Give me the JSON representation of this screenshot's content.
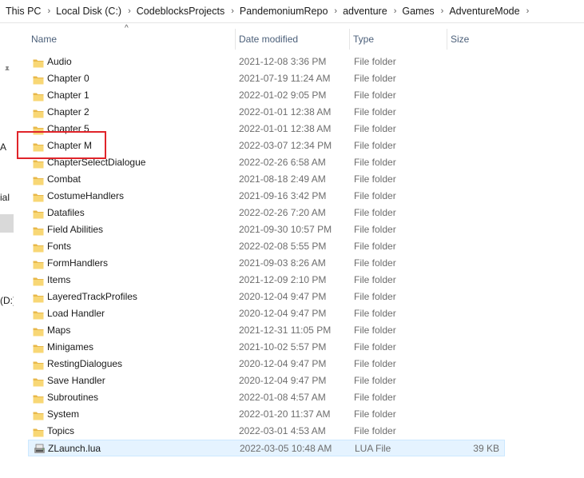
{
  "breadcrumb": [
    "This PC",
    "Local Disk (C:)",
    "CodeblocksProjects",
    "PandemoniumRepo",
    "adventure",
    "Games",
    "AdventureMode"
  ],
  "nav": {
    "fragments": [
      "A",
      "ial",
      "(D:)"
    ]
  },
  "columns": {
    "name": "Name",
    "date": "Date modified",
    "type": "Type",
    "size": "Size"
  },
  "files": [
    {
      "name": "Audio",
      "date": "2021-12-08 3:36 PM",
      "type": "File folder",
      "size": "",
      "icon": "folder-icon"
    },
    {
      "name": "Chapter 0",
      "date": "2021-07-19 11:24 AM",
      "type": "File folder",
      "size": "",
      "icon": "folder-icon"
    },
    {
      "name": "Chapter 1",
      "date": "2022-01-02 9:05 PM",
      "type": "File folder",
      "size": "",
      "icon": "folder-icon"
    },
    {
      "name": "Chapter 2",
      "date": "2022-01-01 12:38 AM",
      "type": "File folder",
      "size": "",
      "icon": "folder-icon"
    },
    {
      "name": "Chapter 5",
      "date": "2022-01-01 12:38 AM",
      "type": "File folder",
      "size": "",
      "icon": "folder-icon"
    },
    {
      "name": "Chapter M",
      "date": "2022-03-07 12:34 PM",
      "type": "File folder",
      "size": "",
      "icon": "folder-icon"
    },
    {
      "name": "ChapterSelectDialogue",
      "date": "2022-02-26 6:58 AM",
      "type": "File folder",
      "size": "",
      "icon": "folder-icon"
    },
    {
      "name": "Combat",
      "date": "2021-08-18 2:49 AM",
      "type": "File folder",
      "size": "",
      "icon": "folder-icon"
    },
    {
      "name": "CostumeHandlers",
      "date": "2021-09-16 3:42 PM",
      "type": "File folder",
      "size": "",
      "icon": "folder-icon"
    },
    {
      "name": "Datafiles",
      "date": "2022-02-26 7:20 AM",
      "type": "File folder",
      "size": "",
      "icon": "folder-icon"
    },
    {
      "name": "Field Abilities",
      "date": "2021-09-30 10:57 PM",
      "type": "File folder",
      "size": "",
      "icon": "folder-icon"
    },
    {
      "name": "Fonts",
      "date": "2022-02-08 5:55 PM",
      "type": "File folder",
      "size": "",
      "icon": "folder-icon"
    },
    {
      "name": "FormHandlers",
      "date": "2021-09-03 8:26 AM",
      "type": "File folder",
      "size": "",
      "icon": "folder-icon"
    },
    {
      "name": "Items",
      "date": "2021-12-09 2:10 PM",
      "type": "File folder",
      "size": "",
      "icon": "folder-icon"
    },
    {
      "name": "LayeredTrackProfiles",
      "date": "2020-12-04 9:47 PM",
      "type": "File folder",
      "size": "",
      "icon": "folder-icon"
    },
    {
      "name": "Load Handler",
      "date": "2020-12-04 9:47 PM",
      "type": "File folder",
      "size": "",
      "icon": "folder-icon"
    },
    {
      "name": "Maps",
      "date": "2021-12-31 11:05 PM",
      "type": "File folder",
      "size": "",
      "icon": "folder-icon"
    },
    {
      "name": "Minigames",
      "date": "2021-10-02 5:57 PM",
      "type": "File folder",
      "size": "",
      "icon": "folder-icon"
    },
    {
      "name": "RestingDialogues",
      "date": "2020-12-04 9:47 PM",
      "type": "File folder",
      "size": "",
      "icon": "folder-icon"
    },
    {
      "name": "Save Handler",
      "date": "2020-12-04 9:47 PM",
      "type": "File folder",
      "size": "",
      "icon": "folder-icon"
    },
    {
      "name": "Subroutines",
      "date": "2022-01-08 4:57 AM",
      "type": "File folder",
      "size": "",
      "icon": "folder-icon"
    },
    {
      "name": "System",
      "date": "2022-01-20 11:37 AM",
      "type": "File folder",
      "size": "",
      "icon": "folder-icon"
    },
    {
      "name": "Topics",
      "date": "2022-03-01 4:53 AM",
      "type": "File folder",
      "size": "",
      "icon": "folder-icon"
    },
    {
      "name": "ZLaunch.lua",
      "date": "2022-03-05 10:48 AM",
      "type": "LUA File",
      "size": "39 KB",
      "icon": "lua-file-icon"
    }
  ],
  "colors": {
    "folder": "#f8d775",
    "folder_dark": "#e8b84a",
    "highlight": "#e0242a",
    "header_text": "#4c607a"
  }
}
